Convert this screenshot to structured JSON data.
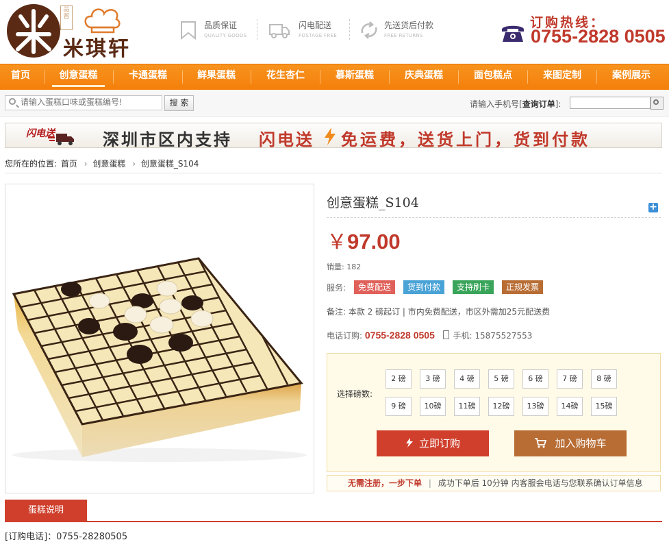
{
  "brand": {
    "name": "米琪轩",
    "tag": "品質",
    "logo_char": "米"
  },
  "features": [
    {
      "title": "品质保证",
      "sub": "QUALITY GOODS",
      "icon": "bookmark-icon"
    },
    {
      "title": "闪电配送",
      "sub": "POSTAGE FREE",
      "icon": "truck-icon"
    },
    {
      "title": "先送货后付款",
      "sub": "FREE RETURNS",
      "icon": "recycle-icon"
    }
  ],
  "hotline": {
    "label": "订购热线：",
    "number": "0755-2828 0505",
    "icon": "telephone-icon"
  },
  "nav": {
    "items": [
      "首页",
      "创意蛋糕",
      "卡通蛋糕",
      "鲜果蛋糕",
      "花生杏仁",
      "慕斯蛋糕",
      "庆典蛋糕",
      "面包糕点",
      "来图定制",
      "案例展示"
    ],
    "active_index": 1
  },
  "search": {
    "placeholder": "请输入蛋糕口味或蛋糕编号!",
    "button": "搜 索",
    "order_label_prefix": "请输入手机号[",
    "order_label_bold": "查询订单",
    "order_label_suffix": "]:"
  },
  "banner": {
    "logo_text": "闪电送",
    "text1": "深圳市区内支持",
    "text2": "闪电送",
    "text3": "免运费，送货上门，货到付款"
  },
  "breadcrumb": {
    "prefix": "您所在的位置:",
    "items": [
      "首页",
      "创意蛋糕",
      "创意蛋糕_S104"
    ]
  },
  "product": {
    "title": "创意蛋糕_S104",
    "currency": "￥",
    "price": "97.00",
    "sales_label": "销量:",
    "sales": "182",
    "service_label": "服务:",
    "services": [
      {
        "label": "免费配送",
        "color": "#e0605a"
      },
      {
        "label": "货到付款",
        "color": "#4aa3d6"
      },
      {
        "label": "支持刷卡",
        "color": "#3aa55a"
      },
      {
        "label": "正规发票",
        "color": "#b86d35"
      }
    ],
    "note": "备注: 本款 2 磅起订 | 市内免费配送，市区外需加25元配送费",
    "tel_label": "电话订购:",
    "tel": "0755-2828 0505",
    "mobile_label": "手机:",
    "mobile": "15875527553"
  },
  "weights": {
    "label": "选择磅数:",
    "options": [
      "2 磅",
      "3 磅",
      "4 磅",
      "5 磅",
      "6 磅",
      "7 磅",
      "8 磅",
      "9 磅",
      "10磅",
      "11磅",
      "12磅",
      "13磅",
      "14磅",
      "15磅"
    ]
  },
  "actions": {
    "buy": "立即订购",
    "cart": "加入购物车"
  },
  "order_note": {
    "highlight": "无需注册，一步下单",
    "text": "成功下单后 10分钟 内客服会电话与您联系确认订单信息"
  },
  "description": {
    "tab": "蛋糕说明",
    "text": "[订购电话]：0755-28280505"
  },
  "colors": {
    "accent": "#cf3f2c",
    "nav": "#f7931e",
    "brand": "#5a2a14"
  }
}
